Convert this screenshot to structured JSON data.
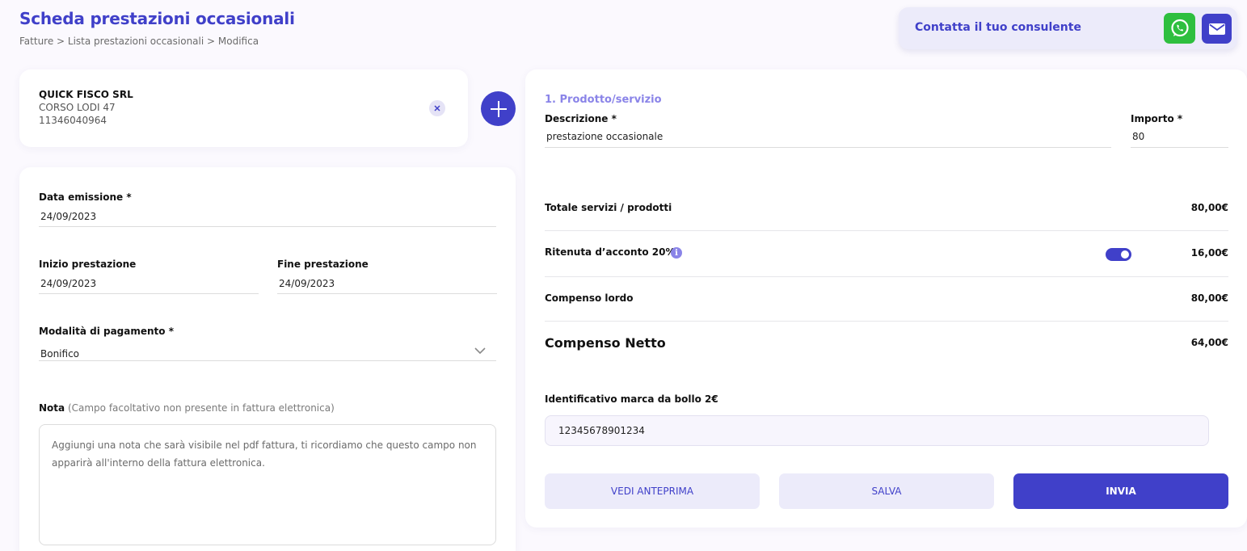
{
  "header": {
    "title": "Scheda prestazioni occasionali",
    "breadcrumb": "Fatture > Lista prestazioni occasionali > Modifica"
  },
  "consultant": {
    "label": "Contatta il tuo consulente",
    "whatsapp_icon": "whatsapp-icon",
    "mail_icon": "mail-icon"
  },
  "client": {
    "name": "QUICK FISCO SRL",
    "address": "CORSO LODI 47",
    "vat": "11346040964"
  },
  "form": {
    "issue_date": {
      "label": "Data emissione *",
      "value": "24/09/2023"
    },
    "start": {
      "label": "Inizio prestazione",
      "value": "24/09/2023"
    },
    "end": {
      "label": "Fine prestazione",
      "value": "24/09/2023"
    },
    "payment": {
      "label": "Modalità di pagamento *",
      "value": "Bonifico"
    },
    "note": {
      "label": "Nota",
      "hint": "(Campo facoltativo non presente in fattura elettronica)",
      "placeholder": "Aggiungi una nota che sarà visibile nel pdf fattura, ti ricordiamo che questo campo non apparirà all'interno della fattura elettronica."
    }
  },
  "products": {
    "section_title": "1. Prodotto/servizio",
    "description_label": "Descrizione *",
    "description_value": "prestazione occasionale",
    "amount_label": "Importo *",
    "amount_value": "80"
  },
  "summary": {
    "total_label": "Totale servizi / prodotti",
    "total_value": "80,00€",
    "withholding_label": "Ritenuta d’acconto 20%",
    "withholding_value": "16,00€",
    "withholding_enabled": true,
    "gross_label": "Compenso lordo",
    "gross_value": "80,00€",
    "net_label": "Compenso Netto",
    "net_value": "64,00€"
  },
  "stamp": {
    "label": "Identificativo marca da bollo 2€",
    "value": "12345678901234"
  },
  "actions": {
    "preview": "VEDI ANTEPRIMA",
    "save": "SALVA",
    "send": "INVIA"
  },
  "colors": {
    "primary": "#4040c9",
    "accent_light": "#ecebfa",
    "section_title": "#8a84e8",
    "whatsapp": "#2ebf3f"
  }
}
